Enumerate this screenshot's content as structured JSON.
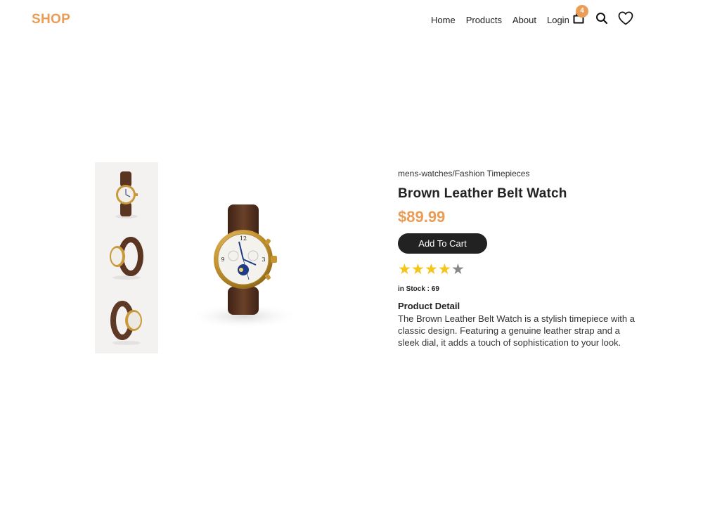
{
  "header": {
    "logo": "SHOP",
    "nav": [
      {
        "label": "Home"
      },
      {
        "label": "Products"
      },
      {
        "label": "About"
      },
      {
        "label": "Login"
      }
    ],
    "cart_count": "4",
    "icons": {
      "cart": "shopping-bag-icon",
      "search": "search-icon",
      "wishlist": "heart-icon"
    }
  },
  "gallery": {
    "thumbnails": [
      "watch-front-thumbnail",
      "watch-side-thumbnail",
      "watch-back-thumbnail"
    ],
    "main_image": "brown-leather-watch-image"
  },
  "product": {
    "breadcrumb": "mens-watches/Fashion Timepieces",
    "title": "Brown Leather Belt Watch",
    "price": "$89.99",
    "add_to_cart_label": "Add To Cart",
    "rating": {
      "value": 4,
      "max": 5
    },
    "stock_text": "in Stock : 69",
    "detail_heading": "Product Detail",
    "description": "The Brown Leather Belt Watch is a stylish timepiece with a classic design. Featuring a genuine leather strap and a sleek dial, it adds a touch of sophistication to your look."
  },
  "colors": {
    "accent": "#ec9d55",
    "text": "#222222",
    "button": "#222222",
    "star_filled": "#f5c518",
    "star_empty": "#888888",
    "thumb_bg": "#f4f1f1"
  }
}
